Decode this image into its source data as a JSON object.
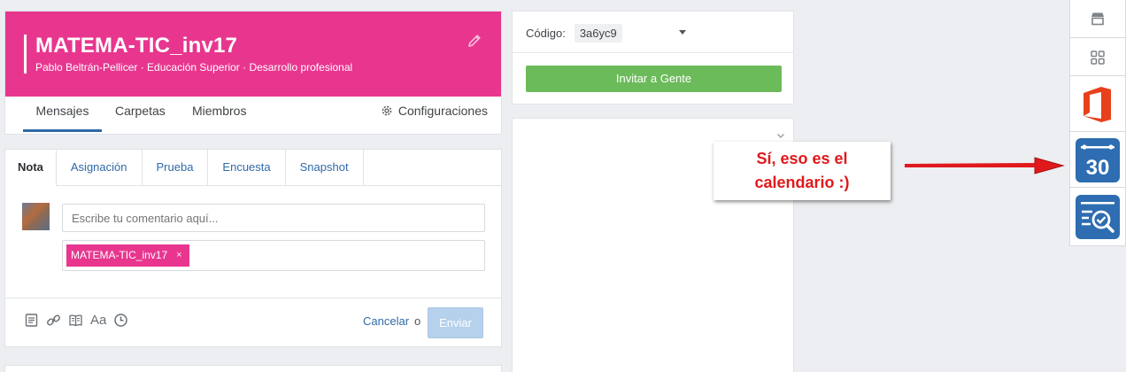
{
  "group": {
    "title": "MATEMA-TIC_inv17",
    "subtitle": "Pablo Beltrán-Pellicer · Educación Superior · Desarrollo profesional",
    "tabs": [
      "Mensajes",
      "Carpetas",
      "Miembros"
    ],
    "settings_label": "Configuraciones",
    "banner_color": "#e8368f"
  },
  "composer": {
    "tabs": [
      "Nota",
      "Asignación",
      "Prueba",
      "Encuesta",
      "Snapshot"
    ],
    "comment_placeholder": "Escribe tu comentario aquí...",
    "recipient_chip": "MATEMA-TIC_inv17",
    "chip_remove": "×",
    "font_tool": "Aa",
    "cancel_label": "Cancelar",
    "or_label": "o",
    "send_label": "Enviar"
  },
  "code_card": {
    "code_label": "Código:",
    "code_value": "3a6yc9",
    "invite_label": "Invitar a Gente",
    "invite_color": "#6cbb5a"
  },
  "callout": {
    "line1": "Sí, eso es el",
    "line2": "calendario :)",
    "color": "#e0191c"
  },
  "rail": {
    "items": [
      "store-icon",
      "apps-grid-icon",
      "office-icon",
      "calendar-icon",
      "quiz-search-icon"
    ],
    "calendar_number": "30"
  }
}
